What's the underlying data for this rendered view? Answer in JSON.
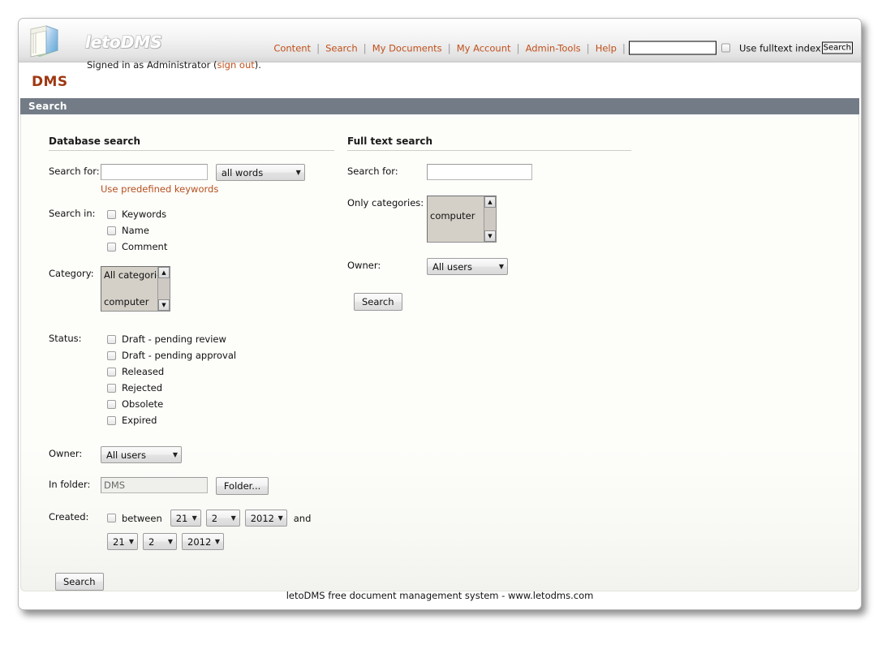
{
  "header": {
    "brand": "letoDMS",
    "logo_icon": "folder-icon",
    "signed_in_prefix": "Signed in as Administrator (",
    "signed_in_user": "Administrator",
    "sign_out_label": "sign out",
    "signed_in_suffix": ").",
    "nav": [
      {
        "label": "Content"
      },
      {
        "label": "Search"
      },
      {
        "label": "My Documents"
      },
      {
        "label": "My Account"
      },
      {
        "label": "Admin-Tools"
      },
      {
        "label": "Help"
      }
    ],
    "separator": "|",
    "search_input_value": "",
    "search_input_placeholder": "",
    "fulltext_checkbox_label": "Use fulltext index",
    "fulltext_checked": false,
    "search_button_label": "Search"
  },
  "page_title": "DMS",
  "section_bar_title": "Search",
  "database_search": {
    "heading": "Database search",
    "search_for_label": "Search for:",
    "search_for_value": "",
    "match_mode": "all words",
    "match_mode_arrow": "chevron-down-icon",
    "predefined_keywords_link": "Use predefined keywords",
    "search_in_label": "Search in:",
    "search_in_options": [
      {
        "label": "Keywords",
        "checked": false
      },
      {
        "label": "Name",
        "checked": false
      },
      {
        "label": "Comment",
        "checked": false
      }
    ],
    "category_label": "Category:",
    "category_options": [
      "All categories",
      "computer"
    ],
    "status_label": "Status:",
    "status_options": [
      {
        "label": "Draft - pending review",
        "checked": false
      },
      {
        "label": "Draft - pending approval",
        "checked": false
      },
      {
        "label": "Released",
        "checked": false
      },
      {
        "label": "Rejected",
        "checked": false
      },
      {
        "label": "Obsolete",
        "checked": false
      },
      {
        "label": "Expired",
        "checked": false
      }
    ],
    "owner_label": "Owner:",
    "owner_value": "All users",
    "in_folder_label": "In folder:",
    "in_folder_value": "DMS",
    "folder_button_label": "Folder...",
    "created_label": "Created:",
    "between_label": "between",
    "between_checked": false,
    "and_label": "and",
    "date_from": {
      "day": "21",
      "month": "2",
      "year": "2012"
    },
    "date_to": {
      "day": "21",
      "month": "2",
      "year": "2012"
    },
    "search_button_label": "Search"
  },
  "fulltext_search": {
    "heading": "Full text search",
    "search_for_label": "Search for:",
    "search_for_value": "",
    "only_categories_label": "Only categories:",
    "only_categories_options": [
      "computer"
    ],
    "owner_label": "Owner:",
    "owner_value": "All users",
    "search_button_label": "Search"
  },
  "footer": {
    "text": "letoDMS free document management system - www.letodms.com"
  },
  "colors": {
    "accent_link": "#c1511c",
    "page_title": "#9e3813",
    "section_bar": "#737c86",
    "panel_bg": "#fdfdfa",
    "listbox_bg": "#d4d0c8"
  }
}
